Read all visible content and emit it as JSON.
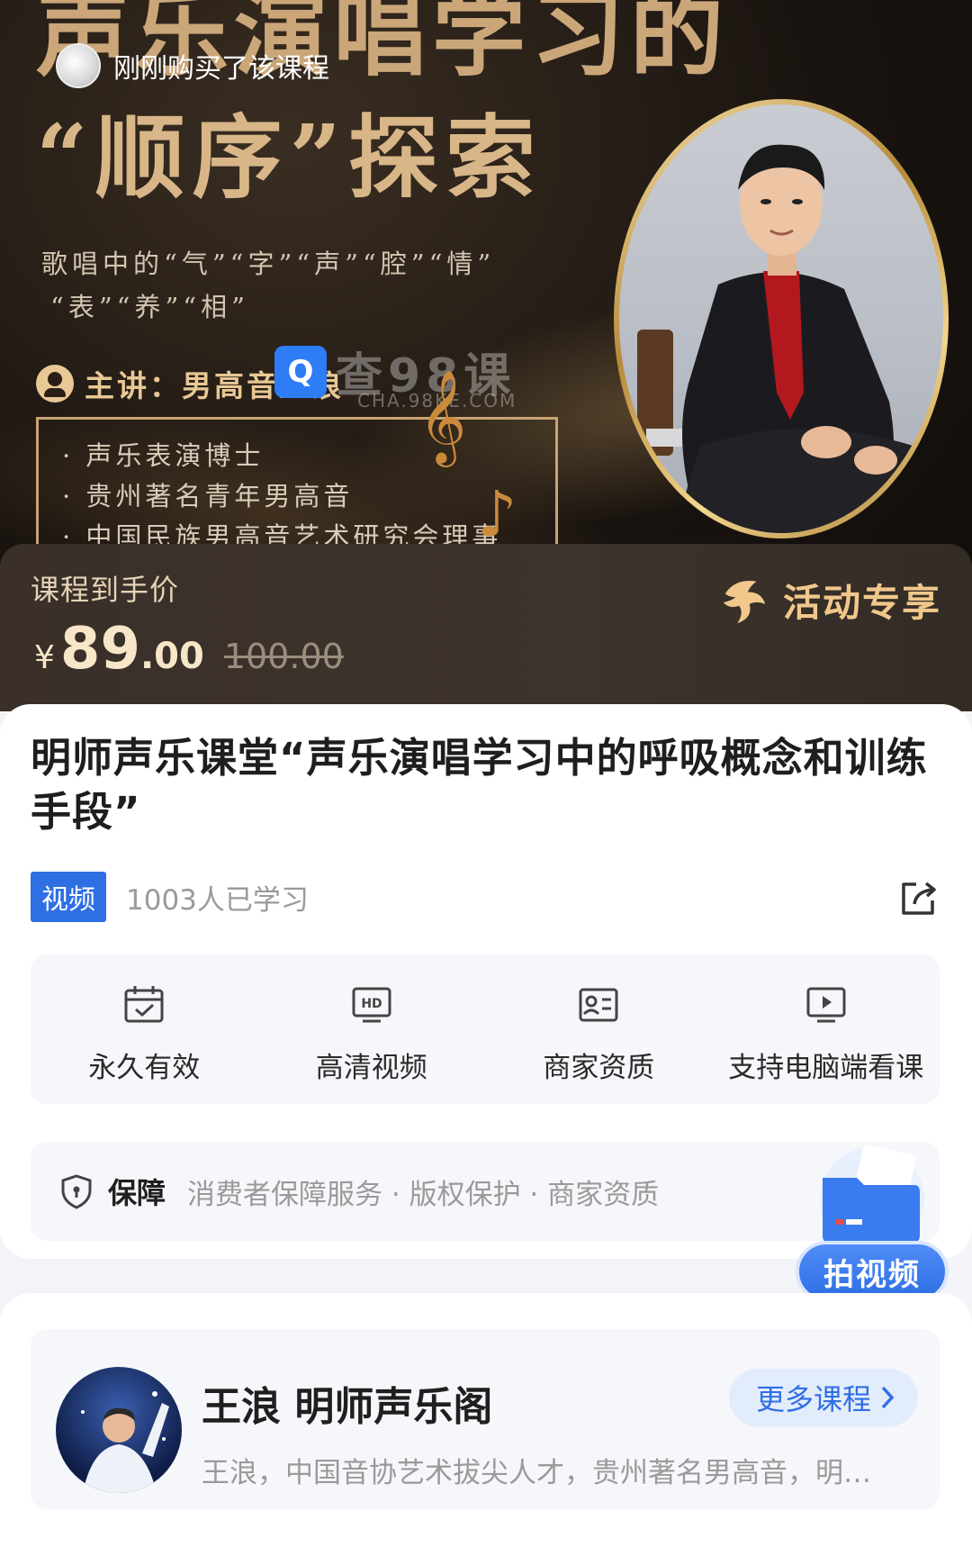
{
  "banner": {
    "title_line1": "声乐演唱学习的",
    "title_line2": "“顺序”探索",
    "purchase_toast": "刚刚购买了该课程",
    "subtitle_line1": "歌唱中的“气”“字”“声”“腔”“情”",
    "subtitle_line2": "“表”“养”“相”",
    "lecturer": "主讲：男高音王浪",
    "watermark_logo": "Q",
    "watermark_text": "查98课",
    "watermark_url": "CHA.98KE.COM",
    "credentials": [
      "· 声乐表演博士",
      "· 贵州著名青年男高音",
      "· 中国民族男高音艺术研究会理事"
    ]
  },
  "price_bar": {
    "label": "课程到手价",
    "currency": "¥",
    "price_int": "89",
    "price_dec": ".00",
    "original_price": "100.00",
    "promo": "活动专享"
  },
  "course": {
    "title": "明师声乐课堂“声乐演唱学习中的呼吸概念和训练手段”",
    "type_badge": "视频",
    "learners": "1003人已学习"
  },
  "features": [
    {
      "icon": "calendar-check-icon",
      "label": "永久有效"
    },
    {
      "icon": "hd-icon",
      "label": "高清视频"
    },
    {
      "icon": "id-card-icon",
      "label": "商家资质"
    },
    {
      "icon": "monitor-play-icon",
      "label": "支持电脑端看课"
    }
  ],
  "guarantee": {
    "title": "保障",
    "items": "消费者保障服务 · 版权保护 · 商家资质"
  },
  "shoot_video": {
    "label": "拍视频"
  },
  "teacher": {
    "name": "王浪 明师声乐阁",
    "description": "王浪，中国音协艺术拔尖人才，贵州著名男高音，明…",
    "more_button": "更多课程"
  },
  "colors": {
    "accent": "#2f6fe4",
    "gold": "#d8b688",
    "price_bar_bg": "#3a3029"
  }
}
